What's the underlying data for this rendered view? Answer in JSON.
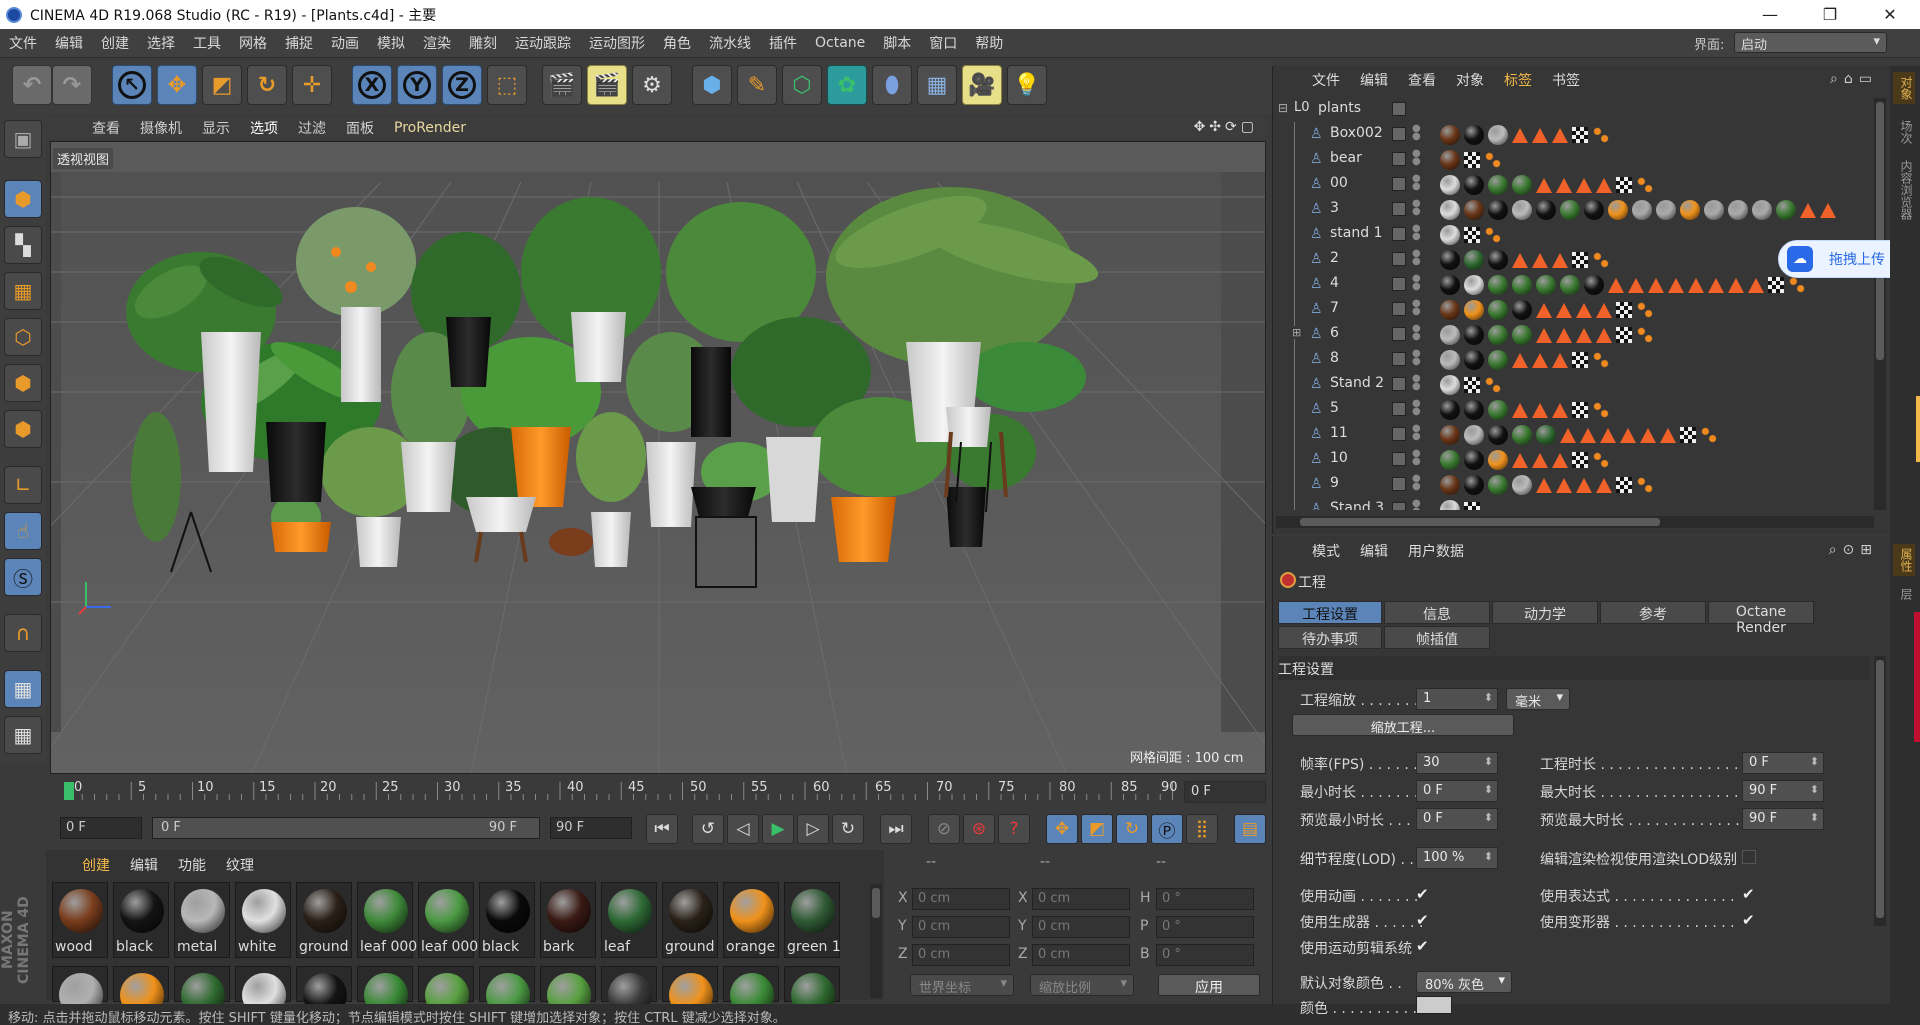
{
  "window": {
    "title": "CINEMA 4D R19.068 Studio (RC - R19) - [Plants.c4d] - 主要",
    "minimize": "—",
    "restore": "❐",
    "close": "✕"
  },
  "menu": [
    "文件",
    "编辑",
    "创建",
    "选择",
    "工具",
    "网格",
    "捕捉",
    "动画",
    "模拟",
    "渲染",
    "雕刻",
    "运动跟踪",
    "运动图形",
    "角色",
    "流水线",
    "插件",
    "Octane",
    "脚本",
    "窗口",
    "帮助"
  ],
  "layout": {
    "label": "界面:",
    "value": "启动"
  },
  "viewport": {
    "menu": [
      "查看",
      "摄像机",
      "显示",
      "选项",
      "过滤",
      "面板",
      "ProRender"
    ],
    "label": "透视视图",
    "grid_spacing": "网格间距 : 100 cm"
  },
  "timeline": {
    "ticks": [
      "0",
      "5",
      "10",
      "15",
      "20",
      "25",
      "30",
      "35",
      "40",
      "45",
      "50",
      "55",
      "60",
      "65",
      "70",
      "75",
      "80",
      "85",
      "90"
    ],
    "current_frame": "0 F",
    "start": "0 F",
    "range_start": "0 F",
    "range_end": "90 F",
    "end": "90 F"
  },
  "materials": {
    "menu": [
      "创建",
      "编辑",
      "功能",
      "纹理"
    ],
    "row1": [
      {
        "name": "wood",
        "color": "#7a3d1c"
      },
      {
        "name": "black",
        "color": "#141414"
      },
      {
        "name": "metal",
        "color": "#b8b8b8"
      },
      {
        "name": "white",
        "color": "#e0e0e0"
      },
      {
        "name": "ground",
        "color": "#2a2018"
      },
      {
        "name": "leaf 000",
        "color": "#3f8a3a"
      },
      {
        "name": "leaf 000",
        "color": "#4c9a44"
      },
      {
        "name": "black",
        "color": "#0a0a0a"
      },
      {
        "name": "bark",
        "color": "#3a1a14"
      },
      {
        "name": "leaf",
        "color": "#2e6a36"
      },
      {
        "name": "ground",
        "color": "#2a2218"
      },
      {
        "name": "orange",
        "color": "#f0921c"
      },
      {
        "name": "green 1",
        "color": "#2f5a34"
      }
    ],
    "row2_colors": [
      "#b0b0b0",
      "#f0921c",
      "#2f6a30",
      "#e0e0e0",
      "#141414",
      "#3a8a36",
      "#58a040",
      "#4c9a44",
      "#58a040",
      "#3a3a3a",
      "#f0921c",
      "#3a8a36",
      "#2f6a30"
    ]
  },
  "coords": {
    "headers": [
      "--",
      "--",
      "--"
    ],
    "rows": [
      {
        "a": "X",
        "av": "0 cm",
        "b": "X",
        "bv": "0 cm",
        "c": "H",
        "cv": "0 °"
      },
      {
        "a": "Y",
        "av": "0 cm",
        "b": "Y",
        "bv": "0 cm",
        "c": "P",
        "cv": "0 °"
      },
      {
        "a": "Z",
        "av": "0 cm",
        "b": "Z",
        "bv": "0 cm",
        "c": "B",
        "cv": "0 °"
      }
    ],
    "world": "世界坐标",
    "scale": "缩放比例",
    "apply": "应用"
  },
  "status": "移动: 点击并拖动鼠标移动元素。按住 SHIFT 键量化移动；节点编辑模式时按住 SHIFT 键增加选择对象；按住 CTRL 键减少选择对象。",
  "objects": {
    "menu": [
      "文件",
      "编辑",
      "查看",
      "对象",
      "标签",
      "书签"
    ],
    "root": "plants",
    "items": [
      {
        "name": "Box002",
        "tags": [
          "#6a3618",
          "#111",
          "#bbb",
          "tri",
          "tri",
          "tri",
          "chk",
          "dots"
        ]
      },
      {
        "name": "bear",
        "tags": [
          "#6a3618",
          "chk",
          "dots"
        ]
      },
      {
        "name": "00",
        "tags": [
          "#ddd",
          "#111",
          "#3a7a30",
          "#3a7a30",
          "tri",
          "tri",
          "tri",
          "tri",
          "chk",
          "dots"
        ]
      },
      {
        "name": "3",
        "tags": [
          "#ddd",
          "#6a3618",
          "#111",
          "#bbb",
          "#111",
          "#3a7a30",
          "#111",
          "#f0921c",
          "#aaa",
          "#aaa",
          "#f0921c",
          "#aaa",
          "#aaa",
          "#aaa",
          "#3a7a30",
          "tri",
          "tri"
        ]
      },
      {
        "name": "stand 1",
        "tags": [
          "#ddd",
          "chk",
          "dots"
        ]
      },
      {
        "name": "2",
        "tags": [
          "#111",
          "#2f6a30",
          "#111",
          "tri",
          "tri",
          "tri",
          "chk",
          "dots"
        ]
      },
      {
        "name": "4",
        "tags": [
          "#111",
          "#ddd",
          "#3a7a30",
          "#3a7a30",
          "#3a7a30",
          "#3a7a30",
          "#111",
          "tri",
          "tri",
          "tri",
          "tri",
          "tri",
          "tri",
          "tri",
          "tri",
          "chk",
          "dots"
        ]
      },
      {
        "name": "7",
        "tags": [
          "#6a3618",
          "#f0921c",
          "#3a7a30",
          "#111",
          "tri",
          "tri",
          "tri",
          "tri",
          "chk",
          "dots"
        ]
      },
      {
        "name": "6",
        "tags": [
          "#bbb",
          "#111",
          "#3a7a30",
          "#3a7a30",
          "tri",
          "tri",
          "tri",
          "tri",
          "chk",
          "dots"
        ]
      },
      {
        "name": "8",
        "tags": [
          "#bbb",
          "#111",
          "#3a7a30",
          "tri",
          "tri",
          "tri",
          "chk",
          "dots"
        ]
      },
      {
        "name": "Stand 2",
        "tags": [
          "#ddd",
          "chk",
          "dots"
        ]
      },
      {
        "name": "5",
        "tags": [
          "#111",
          "#111",
          "#3a7a30",
          "tri",
          "tri",
          "tri",
          "chk",
          "dots"
        ]
      },
      {
        "name": "11",
        "tags": [
          "#6a3618",
          "#bbb",
          "#111",
          "#3a7a30",
          "#2f6a30",
          "tri",
          "tri",
          "tri",
          "tri",
          "tri",
          "tri",
          "chk",
          "dots"
        ]
      },
      {
        "name": "10",
        "tags": [
          "#3a7a30",
          "#111",
          "#f0921c",
          "tri",
          "tri",
          "tri",
          "chk",
          "dots"
        ]
      },
      {
        "name": "9",
        "tags": [
          "#6a3618",
          "#111",
          "#3a7a30",
          "#bbb",
          "tri",
          "tri",
          "tri",
          "tri",
          "chk",
          "dots"
        ]
      },
      {
        "name": "Stand 3",
        "tags": [
          "#ddd",
          "chk"
        ]
      }
    ]
  },
  "upload": {
    "label": "拖拽上传"
  },
  "attributes": {
    "menu": [
      "模式",
      "编辑",
      "用户数据"
    ],
    "title": "工程",
    "tabs_row1": [
      "工程设置",
      "信息",
      "动力学",
      "参考",
      "Octane Render"
    ],
    "tabs_row2": [
      "待办事项",
      "帧插值"
    ],
    "section": "工程设置",
    "project_scale_label": "工程缩放 . . . . . . . .",
    "project_scale_value": "1",
    "project_scale_unit": "毫米",
    "scale_button": "缩放工程...",
    "fps_label": "帧率(FPS) . . . . . .",
    "fps_value": "30",
    "duration_label": "工程时长 . . . . . . . . . . . . . . . .",
    "duration_value": "0 F",
    "min_time_label": "最小时长 . . . . . . .",
    "min_time_value": "0 F",
    "max_time_label": "最大时长 . . . . . . . . . . . . . . . .",
    "max_time_value": "90 F",
    "prev_min_label": "预览最小时长 . . .",
    "prev_min_value": "0 F",
    "prev_max_label": "预览最大时长 . . . . . . . . . . . . . .",
    "prev_max_value": "90 F",
    "lod_label": "细节程度(LOD) . .",
    "lod_value": "100 %",
    "render_lod_label": "编辑渲染检视使用渲染LOD级别",
    "use_anim_label": "使用动画 . . . . . . .",
    "use_expr_label": "使用表达式 . . . . . . . . . . . . . .",
    "use_gen_label": "使用生成器 . . . . . .",
    "use_deform_label": "使用变形器 . . . . . . . . . . . . . .",
    "use_motion_label": "使用运动剪辑系统",
    "check": "✔",
    "default_color_label": "默认对象颜色 . .",
    "default_color_value": "80% 灰色",
    "color_label": "颜色 . . . . . . . . . . ."
  },
  "right_tabs": [
    "对象",
    "场次",
    "内容浏览器",
    "属性",
    "层"
  ],
  "colors": {
    "accent": "#f2b94a",
    "selected_tab": "#5b84b8",
    "viewport_bg": "#585858"
  }
}
